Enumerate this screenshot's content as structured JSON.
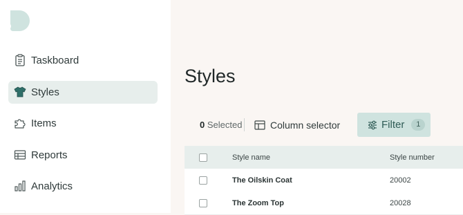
{
  "brand": {
    "logo_icon": "speech-bubble-logo",
    "color": "#cfe3df"
  },
  "sidebar": {
    "items": [
      {
        "label": "Taskboard",
        "icon": "clipboard-icon",
        "active": false
      },
      {
        "label": "Styles",
        "icon": "shirt-icon",
        "active": true
      },
      {
        "label": "Items",
        "icon": "puzzle-icon",
        "active": false
      },
      {
        "label": "Reports",
        "icon": "table-icon",
        "active": false
      },
      {
        "label": "Analytics",
        "icon": "bar-chart-icon",
        "active": false
      }
    ]
  },
  "main": {
    "title": "Styles",
    "toolbar": {
      "selected_count": "0",
      "selected_label": "Selected",
      "column_selector_label": "Column selector",
      "filter_label": "Filter",
      "filter_count": "1"
    },
    "table": {
      "columns": [
        "Style name",
        "Style number"
      ],
      "rows": [
        {
          "name": "The Oilskin Coat",
          "number": "20002"
        },
        {
          "name": "The Zoom Top",
          "number": "20028"
        }
      ]
    }
  },
  "colors": {
    "accent": "#cfe3df",
    "active_nav": "#e7eeec",
    "background": "#faf6f3"
  }
}
